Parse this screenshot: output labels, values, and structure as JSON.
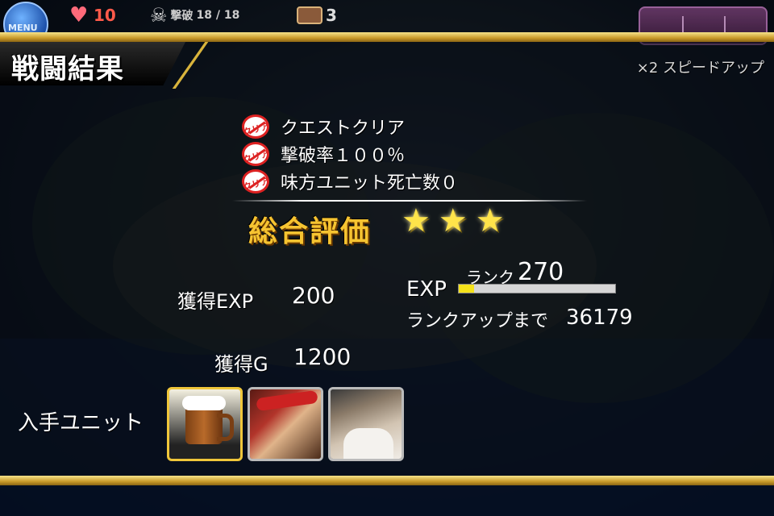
{
  "hud": {
    "menu_label": "MENU",
    "lives": "10",
    "kills_label": "撃破",
    "kills": "18 / 18",
    "chest_count": "3"
  },
  "header": {
    "title": "戦闘結果",
    "speed_up": "×2 スピードアップ"
  },
  "conditions": [
    {
      "badge": "クリア",
      "text": "クエストクリア"
    },
    {
      "badge": "クリア",
      "text": "撃破率１００％"
    },
    {
      "badge": "クリア",
      "text": "味方ユニット死亡数０"
    }
  ],
  "rating": {
    "label": "総合評価",
    "stars": 3
  },
  "rewards": {
    "exp_label": "獲得EXP",
    "exp_value": "200",
    "gold_label": "獲得G",
    "gold_value": "1200"
  },
  "rank": {
    "exp_label": "EXP",
    "rank_label": "ランク",
    "rank_value": "270",
    "progress_fraction": 0.1,
    "rankup_label": "ランクアップまで",
    "rankup_value": "36179"
  },
  "units": {
    "label": "入手ユニット",
    "items": [
      "beer-mug-icon",
      "pirate-portrait",
      "dwarf-portrait"
    ]
  },
  "colors": {
    "gold_band": "#d9b43c",
    "rating_text": "#f6c431",
    "star": "#ffe44a",
    "exp_fill": "#f4e21a",
    "clear_badge": "#dd2222"
  }
}
